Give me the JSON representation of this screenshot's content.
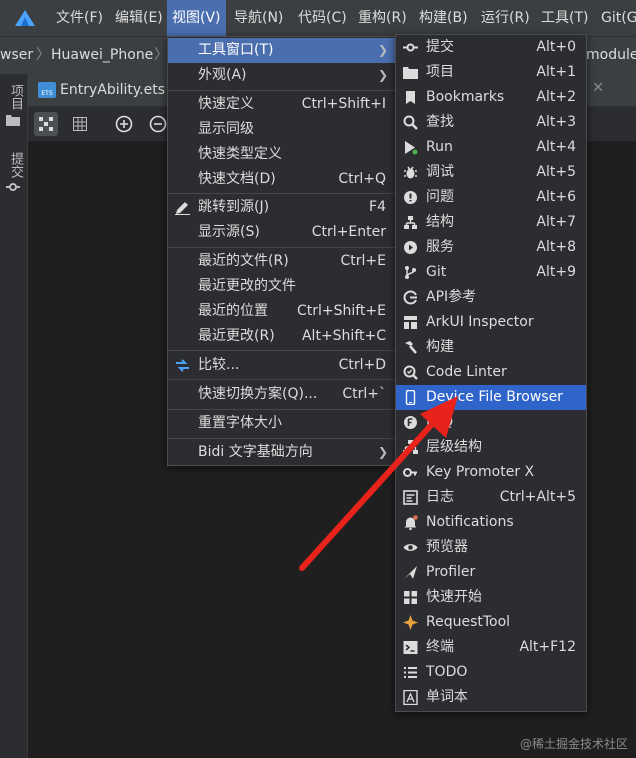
{
  "menubar": {
    "items": [
      "文件(F)",
      "编辑(E)",
      "视图(V)",
      "导航(N)",
      "代码(C)",
      "重构(R)",
      "构建(B)",
      "运行(R)",
      "工具(T)",
      "Git(G)"
    ]
  },
  "breadcrumbs": {
    "left": "wser",
    "device": "Huawei_Phone",
    "right": "module"
  },
  "sidebar": {
    "project_label": "项目",
    "commit_label": "提交"
  },
  "tab": {
    "file": "EntryAbility.ets",
    "badge": "ETS"
  },
  "view_menu": {
    "items": [
      {
        "label": "工具窗口(T)",
        "shortcut": ""
      },
      {
        "label": "外观(A)",
        "shortcut": ""
      },
      {
        "label": "快速定义",
        "shortcut": "Ctrl+Shift+I"
      },
      {
        "label": "显示同级",
        "shortcut": ""
      },
      {
        "label": "快速类型定义",
        "shortcut": ""
      },
      {
        "label": "快速文档(D)",
        "shortcut": "Ctrl+Q"
      },
      {
        "label": "跳转到源(J)",
        "shortcut": "F4"
      },
      {
        "label": "显示源(S)",
        "shortcut": "Ctrl+Enter"
      },
      {
        "label": "最近的文件(R)",
        "shortcut": "Ctrl+E"
      },
      {
        "label": "最近更改的文件",
        "shortcut": ""
      },
      {
        "label": "最近的位置",
        "shortcut": "Ctrl+Shift+E"
      },
      {
        "label": "最近更改(R)",
        "shortcut": "Alt+Shift+C"
      },
      {
        "label": "比较...",
        "shortcut": "Ctrl+D"
      },
      {
        "label": "快速切换方案(Q)...",
        "shortcut": "Ctrl+`"
      },
      {
        "label": "重置字体大小",
        "shortcut": ""
      },
      {
        "label": "Bidi 文字基础方向",
        "shortcut": ""
      }
    ]
  },
  "tool_windows_menu": {
    "items": [
      {
        "label": "提交",
        "shortcut": "Alt+0",
        "icon": "commit-icon"
      },
      {
        "label": "项目",
        "shortcut": "Alt+1",
        "icon": "folder-icon"
      },
      {
        "label": "Bookmarks",
        "shortcut": "Alt+2",
        "icon": "bookmark-icon"
      },
      {
        "label": "查找",
        "shortcut": "Alt+3",
        "icon": "search-icon"
      },
      {
        "label": "Run",
        "shortcut": "Alt+4",
        "icon": "run-icon"
      },
      {
        "label": "调试",
        "shortcut": "Alt+5",
        "icon": "bug-icon"
      },
      {
        "label": "问题",
        "shortcut": "Alt+6",
        "icon": "problem-icon"
      },
      {
        "label": "结构",
        "shortcut": "Alt+7",
        "icon": "structure-icon"
      },
      {
        "label": "服务",
        "shortcut": "Alt+8",
        "icon": "services-icon"
      },
      {
        "label": "Git",
        "shortcut": "Alt+9",
        "icon": "git-icon"
      },
      {
        "label": "API参考",
        "shortcut": "",
        "icon": "api-icon"
      },
      {
        "label": "ArkUI Inspector",
        "shortcut": "",
        "icon": "inspector-icon"
      },
      {
        "label": "构建",
        "shortcut": "",
        "icon": "hammer-icon"
      },
      {
        "label": "Code Linter",
        "shortcut": "",
        "icon": "linter-icon"
      },
      {
        "label": "Device File Browser",
        "shortcut": "",
        "icon": "phone-icon"
      },
      {
        "label": "FAQ",
        "shortcut": "",
        "icon": "faq-icon"
      },
      {
        "label": "层级结构",
        "shortcut": "",
        "icon": "hierarchy-icon"
      },
      {
        "label": "Key Promoter X",
        "shortcut": "",
        "icon": "key-icon"
      },
      {
        "label": "日志",
        "shortcut": "Ctrl+Alt+5",
        "icon": "log-icon"
      },
      {
        "label": "Notifications",
        "shortcut": "",
        "icon": "bell-icon"
      },
      {
        "label": "预览器",
        "shortcut": "",
        "icon": "eye-icon"
      },
      {
        "label": "Profiler",
        "shortcut": "",
        "icon": "profiler-icon"
      },
      {
        "label": "快速开始",
        "shortcut": "",
        "icon": "quickstart-icon"
      },
      {
        "label": "RequestTool",
        "shortcut": "",
        "icon": "request-icon"
      },
      {
        "label": "终端",
        "shortcut": "Alt+F12",
        "icon": "terminal-icon"
      },
      {
        "label": "TODO",
        "shortcut": "",
        "icon": "todo-icon"
      },
      {
        "label": "单词本",
        "shortcut": "",
        "icon": "wordbook-icon"
      }
    ]
  },
  "colors": {
    "menubar_bg": "#3c3f41",
    "menu_bg": "#2b2d30",
    "selection": "#2f65ca",
    "arrow": "#e8231b"
  },
  "watermark": "@稀土掘金技术社区"
}
